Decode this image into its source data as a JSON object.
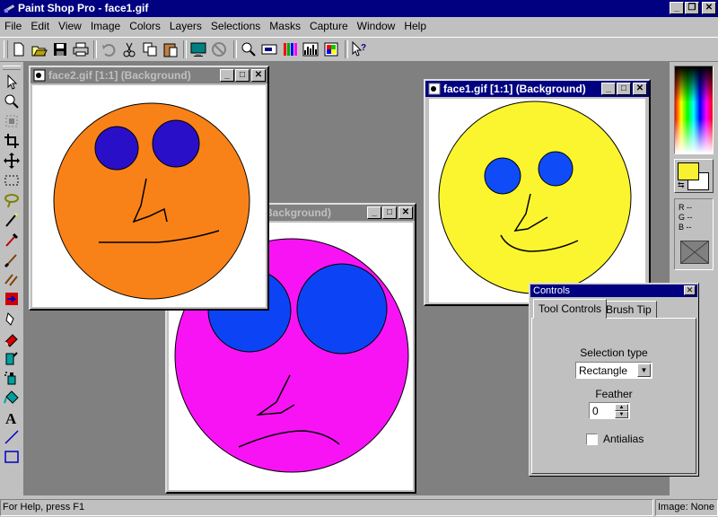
{
  "app": {
    "title": "Paint Shop Pro - face1.gif"
  },
  "menu": [
    "File",
    "Edit",
    "View",
    "Image",
    "Colors",
    "Layers",
    "Selections",
    "Masks",
    "Capture",
    "Window",
    "Help"
  ],
  "toolbar_icons": [
    "new-icon",
    "open-icon",
    "save-icon",
    "print-icon",
    "undo-icon",
    "cut-icon",
    "copy-icon",
    "paste-icon",
    "monitor-icon",
    "stop-icon",
    "zoom-icon",
    "preview-icon",
    "color-bars-icon",
    "histogram-icon",
    "palette-icon",
    "help-pointer-icon"
  ],
  "tools": [
    "arrow-tool-icon",
    "zoom-tool-icon",
    "deformation-tool-icon",
    "crop-tool-icon",
    "mover-tool-icon",
    "selection-tool-icon",
    "freehand-tool-icon",
    "magic-wand-tool-icon",
    "dropper-tool-icon",
    "paintbrush-tool-icon",
    "clone-tool-icon",
    "color-replacer-tool-icon",
    "retouch-tool-icon",
    "eraser-tool-icon",
    "picture-tube-tool-icon",
    "airbrush-tool-icon",
    "flood-fill-tool-icon",
    "text-tool-icon",
    "line-tool-icon",
    "shape-tool-icon"
  ],
  "windows": {
    "face2": {
      "title": "face2.gif [1:1] (Background)"
    },
    "face3": {
      "title": "Background)"
    },
    "face1": {
      "title": "face1.gif [1:1] (Background)"
    }
  },
  "colors": {
    "face2_fill": "#f98218",
    "face2_eyes": "#2a0fc9",
    "face3_fill": "#f813f5",
    "face3_eyes": "#0c44f5",
    "face1_fill": "#fbf52f",
    "face1_eyes": "#0f4cf7",
    "foreground": "#f8f030",
    "background": "#ffffff"
  },
  "color_panel": {
    "r": "R --",
    "g": "G --",
    "b": "B --"
  },
  "controls": {
    "title": "Controls",
    "tabs": [
      "Tool Controls",
      "Brush Tip"
    ],
    "selection_type_label": "Selection type",
    "selection_type_value": "Rectangle",
    "feather_label": "Feather",
    "feather_value": "0",
    "antialias_label": "Antialias",
    "antialias_checked": false
  },
  "status": {
    "help": "For Help, press F1",
    "image": "Image: None"
  }
}
